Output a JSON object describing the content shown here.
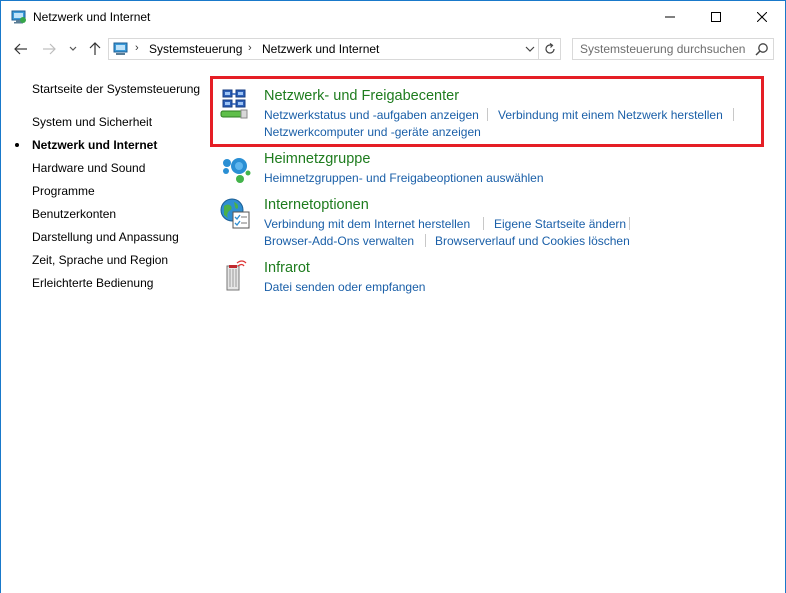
{
  "window": {
    "title": "Netzwerk und Internet",
    "minimize_icon": "minimize-icon",
    "maximize_icon": "maximize-icon",
    "close_icon": "close-icon"
  },
  "address": {
    "crumbs": [
      "Systemsteuerung",
      "Netzwerk und Internet"
    ],
    "search_placeholder": "Systemsteuerung durchsuchen"
  },
  "sidebar": {
    "home": "Startseite der Systemsteuerung",
    "items": [
      {
        "label": "System und Sicherheit",
        "active": false
      },
      {
        "label": "Netzwerk und Internet",
        "active": true
      },
      {
        "label": "Hardware und Sound",
        "active": false
      },
      {
        "label": "Programme",
        "active": false
      },
      {
        "label": "Benutzerkonten",
        "active": false
      },
      {
        "label": "Darstellung und Anpassung",
        "active": false
      },
      {
        "label": "Zeit, Sprache und Region",
        "active": false
      },
      {
        "label": "Erleichterte Bedienung",
        "active": false
      }
    ]
  },
  "categories": [
    {
      "title": "Netzwerk- und Freigabecenter",
      "icon": "network-sharing-center-icon",
      "links": [
        "Netzwerkstatus und -aufgaben anzeigen",
        "Verbindung mit einem Netzwerk herstellen",
        "Netzwerkcomputer und -geräte anzeigen"
      ]
    },
    {
      "title": "Heimnetzgruppe",
      "icon": "homegroup-icon",
      "links": [
        "Heimnetzgruppen- und Freigabeoptionen auswählen"
      ]
    },
    {
      "title": "Internetoptionen",
      "icon": "internet-options-icon",
      "links": [
        "Verbindung mit dem Internet herstellen",
        "Eigene Startseite ändern",
        "Browser-Add-Ons verwalten",
        "Browserverlauf und Cookies löschen"
      ]
    },
    {
      "title": "Infrarot",
      "icon": "infrared-icon",
      "links": [
        "Datei senden oder empfangen"
      ]
    }
  ],
  "colors": {
    "category_title": "#1e7c1e",
    "link": "#1a5fa8",
    "highlight": "#e51e25",
    "window_border": "#1979ca"
  }
}
